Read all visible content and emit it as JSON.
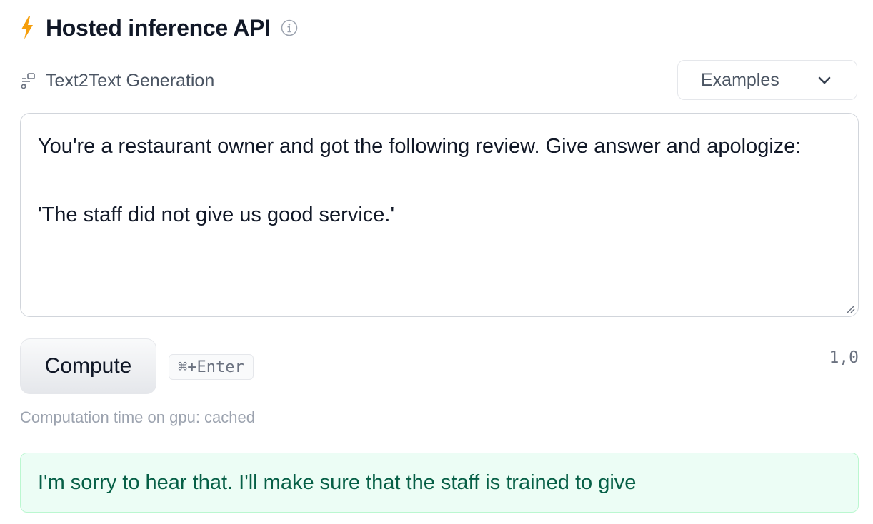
{
  "header": {
    "title": "Hosted inference API",
    "bolt_icon": "lightning-bolt-icon",
    "info_icon": "info-circle-icon"
  },
  "task": {
    "icon": "text2text-task-icon",
    "label": "Text2Text Generation"
  },
  "examples": {
    "label": "Examples",
    "icon": "chevron-down-icon"
  },
  "prompt": {
    "value": "You're a restaurant owner and got the following review. Give answer and apologize:\n\n'The staff did not give us good service.'"
  },
  "compute": {
    "button_label": "Compute",
    "shortcut": "⌘+Enter",
    "counter": "1,0"
  },
  "status": {
    "computation_time": "Computation time on gpu: cached"
  },
  "output": {
    "text": "I'm sorry to hear that. I'll make sure that the staff is trained to give"
  },
  "colors": {
    "bolt": "#f59e0b",
    "output_background": "#ecfdf5",
    "output_border": "#bbf7d0",
    "output_text": "#065f46"
  }
}
